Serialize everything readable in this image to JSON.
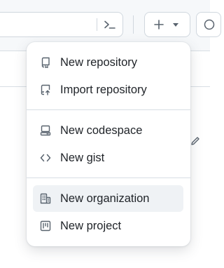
{
  "header": {
    "command_palette_icon": "terminal-icon",
    "create_icon": "plus-icon",
    "create_caret_icon": "triangle-down-icon",
    "next_icon": "circle-icon"
  },
  "create_menu": {
    "groups": [
      [
        {
          "label": "New repository",
          "icon": "repo-icon"
        },
        {
          "label": "Import repository",
          "icon": "repo-push-icon"
        }
      ],
      [
        {
          "label": "New codespace",
          "icon": "codespaces-icon"
        },
        {
          "label": "New gist",
          "icon": "code-icon"
        }
      ],
      [
        {
          "label": "New organization",
          "icon": "organization-icon",
          "highlighted": true
        },
        {
          "label": "New project",
          "icon": "project-icon"
        }
      ]
    ]
  },
  "background": {
    "edit_icon": "pencil-icon"
  },
  "colors": {
    "text": "#1f2328",
    "icon": "#59636e",
    "border": "#d0d7de",
    "highlight": "#eff2f5"
  }
}
